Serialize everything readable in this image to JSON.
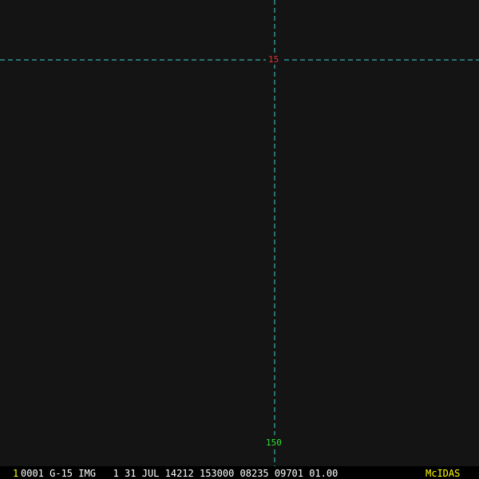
{
  "display": {
    "latitude_label": "15",
    "longitude_label": "150",
    "colors": {
      "background": "#141414",
      "grid_line": "#3fd0d0",
      "latitude_label": "#e03030",
      "longitude_label": "#30e030"
    }
  },
  "status_bar": {
    "frame_number": "1",
    "frame_info": "0001 G-15 IMG   1 31 JUL 14212 153000 08235 09701 01.00",
    "brand": "McIDAS",
    "colors": {
      "frame_number": "#ffff00",
      "frame_info": "#ffffff",
      "brand": "#ffff00"
    }
  }
}
